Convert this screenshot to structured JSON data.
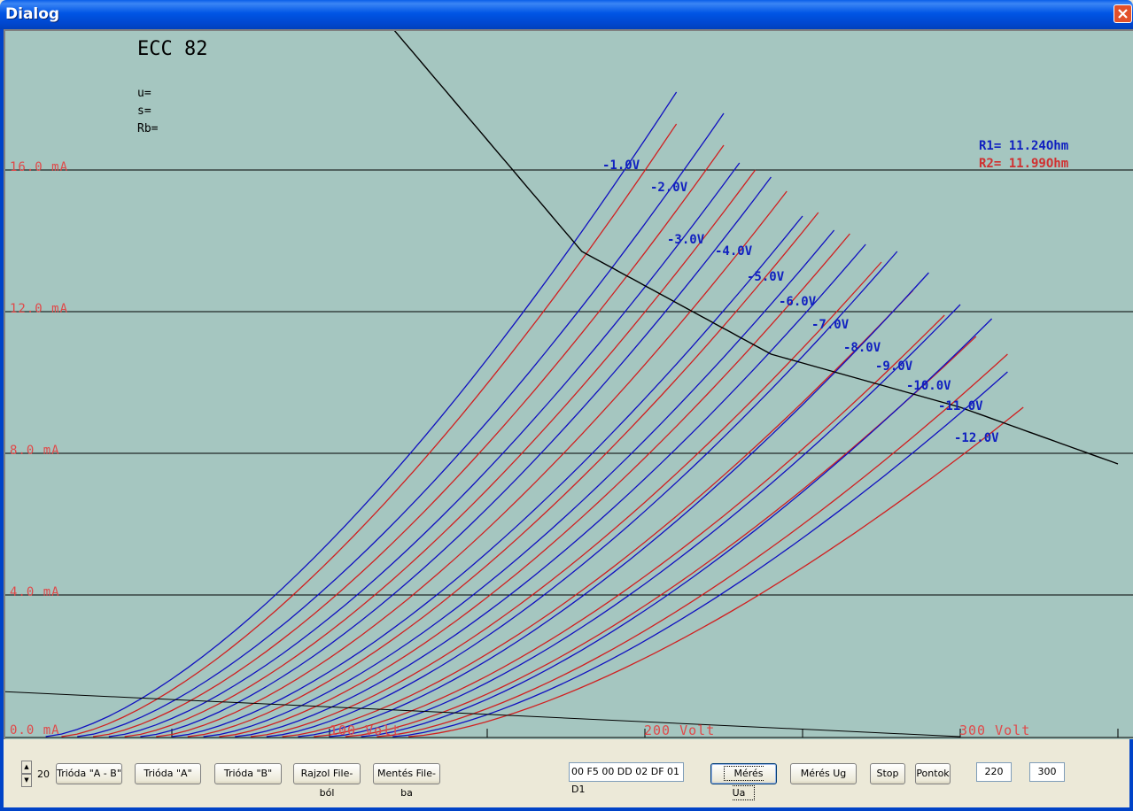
{
  "window": {
    "title": "Dialog"
  },
  "plot": {
    "tube": "ECC 82",
    "params": [
      "u=",
      "s=",
      "Rb="
    ],
    "r1": "R1= 11.24Ohm",
    "r2": "R2= 11.99Ohm",
    "y_labels": [
      "16.0 mA",
      "12.0 mA",
      "8.0 mA",
      "4.0 mA",
      "0.0 mA"
    ],
    "x_labels": [
      "100 Volt",
      "200 Volt",
      "300 Volt"
    ],
    "grid_labels": [
      "-1.0V",
      "-2.0V",
      "-3.0V",
      "-4.0V",
      "-5.0V",
      "-6.0V",
      "-7.0V",
      "-8.0V",
      "-9.0V",
      "-10.0V",
      "-11.0V",
      "-12.0V"
    ],
    "colors": {
      "bg": "#a5c6c0",
      "curve_a": "#1010c0",
      "curve_b": "#d02020",
      "axis_label": "#e04a4a"
    }
  },
  "chart_data": {
    "type": "line",
    "xlabel": "",
    "ylabel": "",
    "xlim": [
      -10,
      350
    ],
    "ylim": [
      0,
      20
    ],
    "grid": true,
    "curves_grid_voltage": [
      -1.0,
      -2.0,
      -3.0,
      -4.0,
      -5.0,
      -6.0,
      -7.0,
      -8.0,
      -9.0,
      -10.0,
      -11.0,
      -12.0
    ],
    "series_a": {
      "color": "#1010c0",
      "start_x": [
        10,
        20,
        30,
        40,
        50,
        60,
        70,
        80,
        90,
        100,
        110,
        120
      ],
      "end_x": [
        210,
        225,
        230,
        240,
        250,
        260,
        270,
        280,
        290,
        300,
        310,
        315
      ],
      "end_y": [
        18.2,
        17.6,
        16.2,
        15.8,
        14.7,
        14.3,
        13.9,
        13.7,
        13.1,
        12.2,
        11.8,
        10.3
      ]
    },
    "series_b": {
      "color": "#d02020",
      "start_x": [
        15,
        25,
        35,
        45,
        55,
        65,
        75,
        85,
        95,
        105,
        115,
        125
      ],
      "end_x": [
        210,
        225,
        235,
        245,
        255,
        265,
        275,
        285,
        295,
        305,
        315,
        320
      ],
      "end_y": [
        17.3,
        16.7,
        16.0,
        15.4,
        14.8,
        14.2,
        13.4,
        12.6,
        11.9,
        11.3,
        10.8,
        9.3
      ]
    },
    "load_curve": {
      "color": "#000000",
      "x": [
        120,
        180,
        240,
        300,
        350
      ],
      "y": [
        20,
        13.7,
        10.8,
        9.3,
        7.7
      ]
    },
    "load_line": {
      "color": "#000000",
      "x": [
        -10,
        300
      ],
      "y": [
        1.3,
        0
      ]
    }
  },
  "toolbar": {
    "spin_value": "20",
    "btn_trioda_ab": "Trióda \"A - B\"",
    "btn_trioda_a": "Trióda  \"A\"",
    "btn_trioda_b": "Trióda  \"B\"",
    "btn_rajzol": "Rajzol File-ból",
    "btn_mentes": "Mentés File-ba",
    "hex_field": "00 F5 00 DD 02 DF 01 D1",
    "btn_meres_ua": "Mérés Ua",
    "btn_meres_ug": "Mérés Ug",
    "btn_stop": "Stop",
    "btn_pontok": "Pontok",
    "field_1": "220",
    "field_2": "300"
  }
}
